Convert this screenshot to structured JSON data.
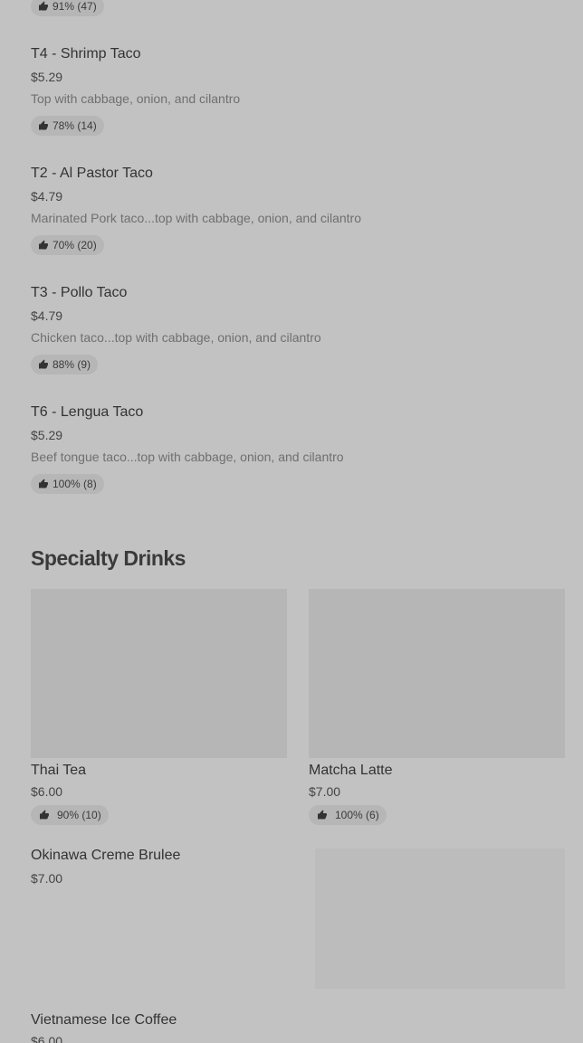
{
  "top_rating": {
    "label": "91% (47)"
  },
  "tacos": [
    {
      "name": "T4 - Shrimp Taco",
      "price": "$5.29",
      "description": "Top with cabbage, onion, and cilantro",
      "rating": "78% (14)"
    },
    {
      "name": "T2 - Al Pastor Taco",
      "price": "$4.79",
      "description": "Marinated Pork taco...top with cabbage, onion, and cilantro",
      "rating": "70% (20)"
    },
    {
      "name": "T3 - Pollo Taco",
      "price": "$4.79",
      "description": "Chicken taco...top with cabbage, onion, and cilantro",
      "rating": "88% (9)"
    },
    {
      "name": "T6 - Lengua Taco",
      "price": "$5.29",
      "description": "Beef tongue taco...top with cabbage, onion, and cilantro",
      "rating": "100% (8)"
    }
  ],
  "specialty_drinks": {
    "title": "Specialty Drinks",
    "items": [
      {
        "name": "Thai Tea",
        "price": "$6.00",
        "rating": "90% (10)"
      },
      {
        "name": "Matcha Latte",
        "price": "$7.00",
        "rating": "100% (6)"
      },
      {
        "name": "Okinawa Creme Brulee",
        "price": "$7.00"
      },
      {
        "name": "Vietnamese Ice Coffee",
        "price": "$6.00"
      }
    ]
  },
  "icons": {
    "rating": "thumbs-up-icon"
  }
}
